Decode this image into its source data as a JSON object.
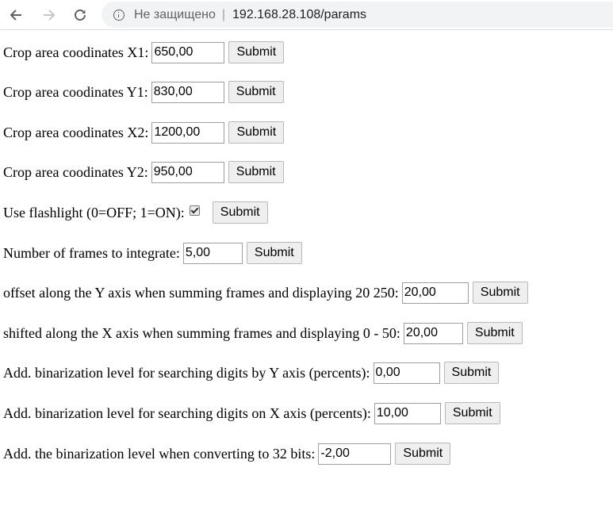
{
  "browser": {
    "security_text": "Не защищено",
    "separator": "|",
    "url": "192.168.28.108/params",
    "back_icon": "arrow-left-icon",
    "forward_icon": "arrow-right-icon",
    "reload_icon": "reload-icon",
    "info_icon": "info-circle-icon"
  },
  "form": {
    "submit_label": "Submit",
    "rows": [
      {
        "label": "Crop area coodinates X1:",
        "value": "650,00"
      },
      {
        "label": "Crop area coodinates Y1:",
        "value": "830,00"
      },
      {
        "label": "Crop area coodinates X2:",
        "value": "1200,00"
      },
      {
        "label": "Crop area coodinates Y2:",
        "value": "950,00"
      },
      {
        "label": "Use flashlight (0=OFF; 1=ON):",
        "checked": true
      },
      {
        "label": "Number of frames to integrate:",
        "value": "5,00"
      },
      {
        "label": "offset along the Y axis when summing frames and displaying 20 250:",
        "value": "20,00"
      },
      {
        "label": "shifted along the X axis when summing frames and displaying 0 - 50:",
        "value": "20,00"
      },
      {
        "label": "Add. binarization level for searching digits by Y axis (percents):",
        "value": "0,00"
      },
      {
        "label": "Add. binarization level for searching digits on X axis (percents):",
        "value": "10,00"
      },
      {
        "label": "Add. the binarization level when converting to 32 bits:",
        "value": "-2,00"
      }
    ]
  }
}
